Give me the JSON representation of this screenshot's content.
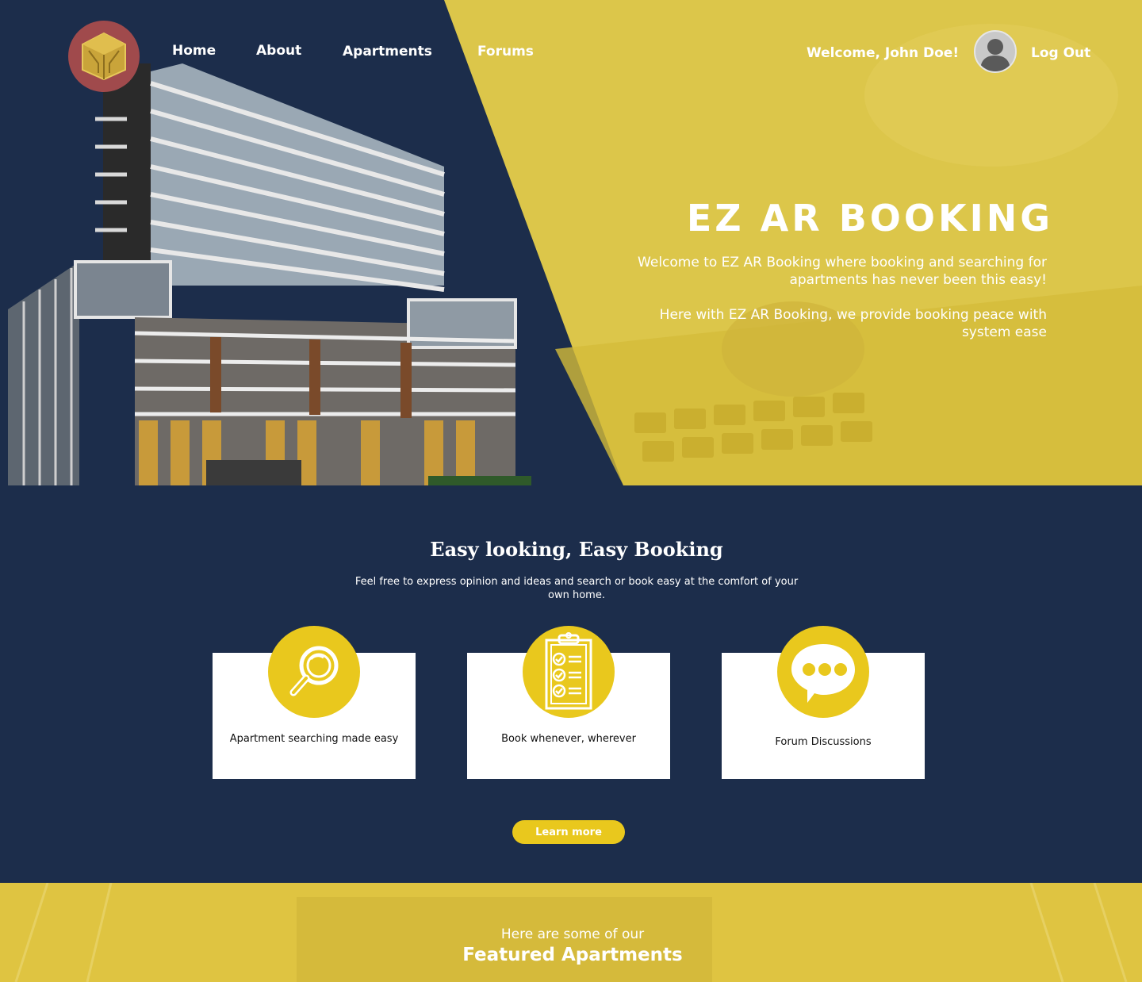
{
  "nav": {
    "home": "Home",
    "about": "About",
    "apartments": "Apartments",
    "forums": "Forums"
  },
  "user": {
    "welcome": "Welcome, John Doe!",
    "logout": "Log Out"
  },
  "hero": {
    "title": "EZ AR BOOKING",
    "paragraph1": "Welcome to EZ AR Booking where booking and searching for apartments has never been this easy!",
    "paragraph2": "Here with EZ AR Booking, we provide booking peace with system ease"
  },
  "features": {
    "title": "Easy looking, Easy Booking",
    "subtitle": "Feel free to express opinion and ideas and search or book easy at the comfort of your own home.",
    "cards": [
      {
        "icon": "magnifier-icon",
        "label": "Apartment searching made easy"
      },
      {
        "icon": "clipboard-checklist-icon",
        "label": "Book whenever, wherever"
      },
      {
        "icon": "chat-bubble-icon",
        "label": "Forum Discussions"
      }
    ],
    "button": "Learn more"
  },
  "featured": {
    "intro": "Here are some of our",
    "title": "Featured Apartments"
  },
  "colors": {
    "navy": "#1c2d4b",
    "yellow": "#e9c81d",
    "hero_yellow": "#ddc64c",
    "logo_red": "#a04a4c"
  }
}
